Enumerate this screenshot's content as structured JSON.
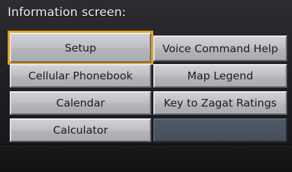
{
  "header": {
    "title": "Information screen:"
  },
  "menu": {
    "left": [
      {
        "label": "Setup",
        "selected": true
      },
      {
        "label": "Cellular Phonebook"
      },
      {
        "label": "Calendar"
      },
      {
        "label": "Calculator"
      }
    ],
    "right": [
      {
        "label": "Voice Command Help"
      },
      {
        "label": "Map Legend"
      },
      {
        "label": "Key to Zagat Ratings"
      },
      {
        "label": ""
      }
    ]
  },
  "colors": {
    "selection_outline": "#e7a21a",
    "button_face": "#bfc1c6",
    "empty_slot": "#4a5460",
    "background": "#232328"
  }
}
